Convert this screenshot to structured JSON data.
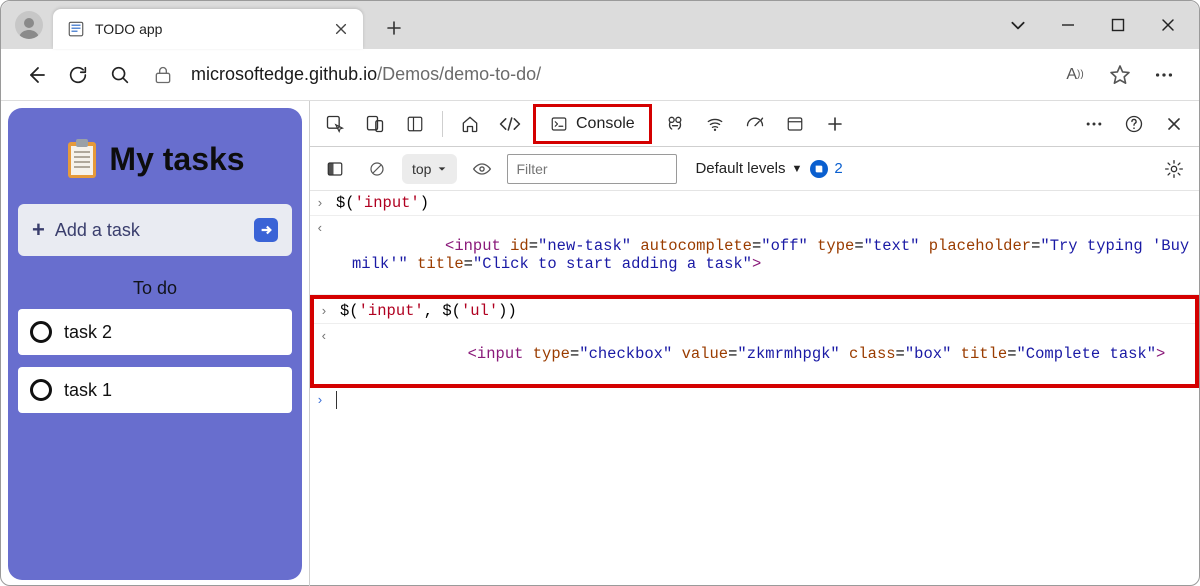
{
  "tab": {
    "title": "TODO app"
  },
  "url": {
    "host": "microsoftedge.github.io",
    "path": "/Demos/demo-to-do/"
  },
  "app": {
    "title": "My tasks",
    "add_task": "Add a task",
    "section": "To do",
    "tasks": [
      "task 2",
      "task 1"
    ]
  },
  "devtools": {
    "console_tab": "Console",
    "context": "top",
    "filter_placeholder": "Filter",
    "levels": "Default levels",
    "issue_count": "2"
  },
  "console": {
    "l1_expr": "$('input')",
    "l2_out_a": "<input",
    "l2_out_attrs": " id=\"new-task\" autocomplete=\"off\" type=\"text\" placeholder=\"Try typing 'Buy milk'\" title=\"Click to start adding a task\"",
    "l2_out_b": ">",
    "l3_expr": "$('input', $('ul'))",
    "l4_out_a": "<input",
    "l4_out_attrs": " type=\"checkbox\" value=\"zkmrmhpgk\" class=\"box\" title=\"Complete task\"",
    "l4_out_b": ">"
  }
}
